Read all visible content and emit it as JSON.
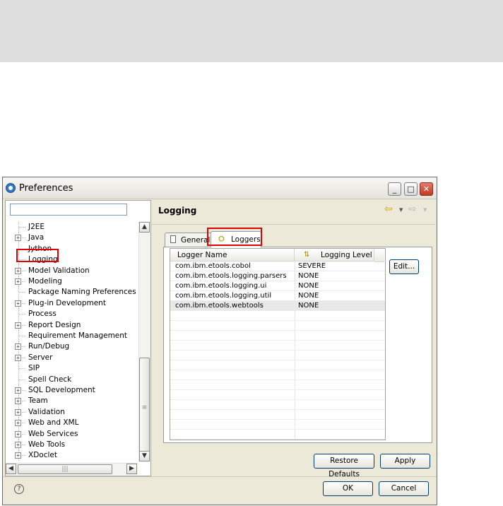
{
  "window": {
    "title": "Preferences"
  },
  "window_buttons": {
    "minimize": "_",
    "maximize": "□",
    "close": "✕"
  },
  "tree": {
    "items": [
      {
        "label": "J2EE",
        "expandable": false
      },
      {
        "label": "Java",
        "expandable": true
      },
      {
        "label": "Jython",
        "expandable": false
      },
      {
        "label": "Logging",
        "expandable": false,
        "highlighted": true
      },
      {
        "label": "Model Validation",
        "expandable": true
      },
      {
        "label": "Modeling",
        "expandable": true
      },
      {
        "label": "Package Naming Preferences",
        "expandable": false
      },
      {
        "label": "Plug-in Development",
        "expandable": true
      },
      {
        "label": "Process",
        "expandable": false
      },
      {
        "label": "Report Design",
        "expandable": true
      },
      {
        "label": "Requirement Management",
        "expandable": false
      },
      {
        "label": "Run/Debug",
        "expandable": true
      },
      {
        "label": "Server",
        "expandable": true
      },
      {
        "label": "SIP",
        "expandable": false
      },
      {
        "label": "Spell Check",
        "expandable": false
      },
      {
        "label": "SQL Development",
        "expandable": true
      },
      {
        "label": "Team",
        "expandable": true
      },
      {
        "label": "Validation",
        "expandable": true
      },
      {
        "label": "Web and XML",
        "expandable": true
      },
      {
        "label": "Web Services",
        "expandable": true
      },
      {
        "label": "Web Tools",
        "expandable": true
      },
      {
        "label": "XDoclet",
        "expandable": true
      }
    ]
  },
  "page": {
    "title": "Logging"
  },
  "tabs": [
    {
      "label": "General",
      "icon": "page-icon",
      "selected": false
    },
    {
      "label": "Loggers",
      "icon": "loggers-icon",
      "selected": true
    }
  ],
  "table": {
    "headers": [
      "Logger Name",
      "Logging Level"
    ],
    "rows": [
      {
        "name": "com.ibm.etools.cobol",
        "level": "SEVERE"
      },
      {
        "name": "com.ibm.etools.logging.parsers",
        "level": "NONE"
      },
      {
        "name": "com.ibm.etools.logging.ui",
        "level": "NONE"
      },
      {
        "name": "com.ibm.etools.logging.util",
        "level": "NONE"
      },
      {
        "name": "com.ibm.etools.webtools",
        "level": "NONE",
        "selected": true
      }
    ]
  },
  "buttons": {
    "edit": "Edit...",
    "restore_defaults": "Restore Defaults",
    "apply": "Apply",
    "ok": "OK",
    "cancel": "Cancel"
  },
  "icons": {
    "back": "back-arrow-icon",
    "forward": "forward-arrow-icon",
    "help": "help-icon"
  },
  "colors": {
    "highlight_box": "#e00000",
    "back_arrow": "#d2a100",
    "title_icon": "#2f78c4"
  }
}
